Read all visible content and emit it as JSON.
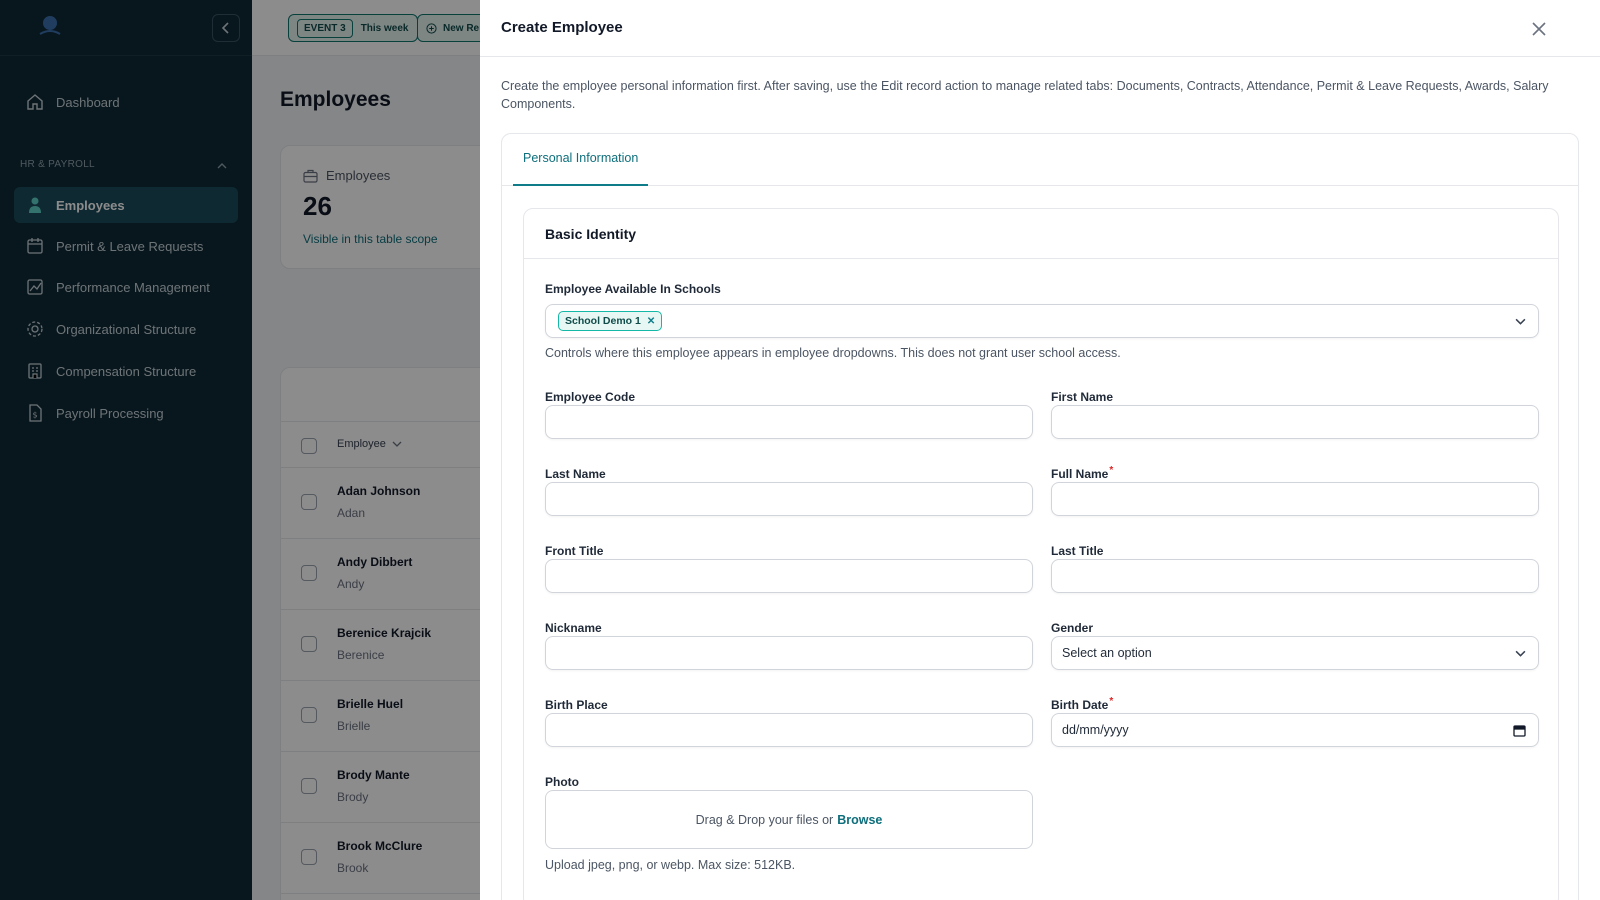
{
  "sidebar": {
    "items": [
      {
        "label": "Dashboard",
        "icon": "home-icon"
      },
      {
        "label": "Employees",
        "icon": "user-icon",
        "active": true
      },
      {
        "label": "Permit & Leave Requests",
        "icon": "calendar-icon"
      },
      {
        "label": "Performance Management",
        "icon": "chart-icon"
      },
      {
        "label": "Organizational Structure",
        "icon": "gear-icon"
      },
      {
        "label": "Compensation Structure",
        "icon": "building-icon"
      },
      {
        "label": "Payroll Processing",
        "icon": "dollar-doc-icon"
      }
    ],
    "section_label": "HR & PAYROLL"
  },
  "header": {
    "event_tag": "EVENT 3",
    "event_range": "This week",
    "new_label": "New Re"
  },
  "main": {
    "page_title": "Employees",
    "stat": {
      "label": "Employees",
      "value": "26",
      "sub": "Visible in this table scope"
    },
    "table": {
      "column": "Employee",
      "rows": [
        {
          "name": "Adan Johnson",
          "nick": "Adan"
        },
        {
          "name": "Andy Dibbert",
          "nick": "Andy"
        },
        {
          "name": "Berenice Krajcik",
          "nick": "Berenice"
        },
        {
          "name": "Brielle Huel",
          "nick": "Brielle"
        },
        {
          "name": "Brody Mante",
          "nick": "Brody"
        },
        {
          "name": "Brook McClure",
          "nick": "Brook"
        }
      ]
    }
  },
  "modal": {
    "title": "Create Employee",
    "description": "Create the employee personal information first. After saving, use the Edit record action to manage related tabs: Documents, Contracts, Attendance, Permit & Leave Requests, Awards, Salary Components.",
    "tab": "Personal Information",
    "section_title": "Basic Identity",
    "schools": {
      "label": "Employee Available In Schools",
      "chip": "School Demo 1",
      "hint": "Controls where this employee appears in employee dropdowns. This does not grant user school access."
    },
    "fields": {
      "employee_code": "Employee Code",
      "first_name": "First Name",
      "last_name": "Last Name",
      "full_name": "Full Name",
      "front_title": "Front Title",
      "last_title": "Last Title",
      "nickname": "Nickname",
      "gender": "Gender",
      "gender_value": "Select an option",
      "birth_place": "Birth Place",
      "birth_date": "Birth Date",
      "birth_date_placeholder": "dd/mm/yyyy",
      "photo": "Photo"
    },
    "photo": {
      "drop_text": "Drag & Drop your files or",
      "browse": "Browse",
      "hint": "Upload jpeg, png, or webp. Max size: 512KB."
    },
    "required_mark": "*"
  },
  "colors": {
    "sidebar_bg": "#0f2a36",
    "accent": "#0e7d89",
    "required": "#dc2626"
  }
}
